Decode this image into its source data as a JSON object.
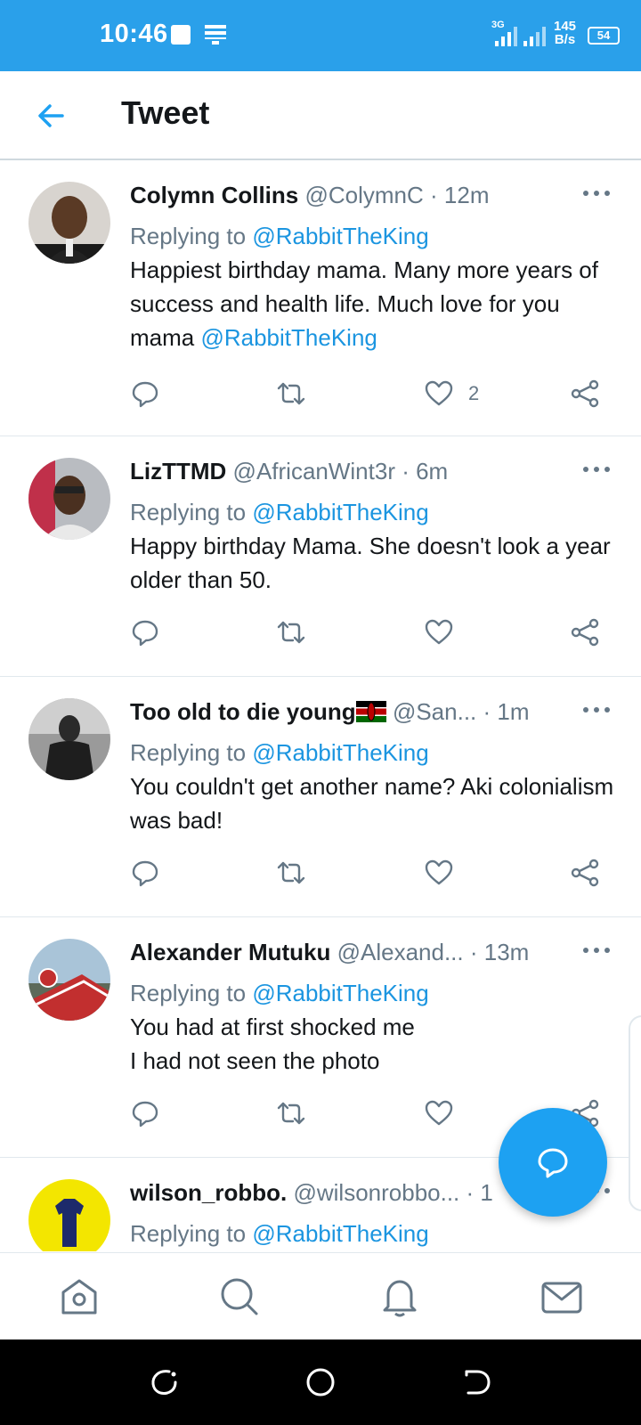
{
  "status_bar": {
    "time": "10:46",
    "network": "3G",
    "speed_value": "145",
    "speed_unit": "B/s",
    "battery": "54"
  },
  "header": {
    "title": "Tweet",
    "back_icon": "arrow-left-icon"
  },
  "tweets": [
    {
      "name": "Colymn Collins",
      "handle": "@ColymnC",
      "time": "· 12m",
      "replying_prefix": "Replying to ",
      "replying_to": "@RabbitTheKing",
      "text": "Happiest birthday mama.  Many more years of success and health life. Much love for you mama ",
      "text_mention": "@RabbitTheKing",
      "likes": "2"
    },
    {
      "name": "LizTTMD",
      "handle": "@AfricanWint3r",
      "time": "· 6m",
      "replying_prefix": "Replying to ",
      "replying_to": "@RabbitTheKing",
      "text": "Happy birthday Mama. She doesn't look a year older than 50.",
      "text_mention": "",
      "likes": ""
    },
    {
      "name": "Too old to die young",
      "handle": "@San...",
      "time": "· 1m",
      "replying_prefix": "Replying to ",
      "replying_to": "@RabbitTheKing",
      "text": "You couldn't get another name? Aki colonialism was bad!",
      "text_mention": "",
      "likes": ""
    },
    {
      "name": "Alexander Mutuku",
      "handle": "@Alexand...",
      "time": "· 13m",
      "replying_prefix": "Replying to ",
      "replying_to": "@RabbitTheKing",
      "text": "You had at first shocked me\nI had not seen the photo",
      "text_mention": "",
      "likes": ""
    },
    {
      "name": "wilson_robbo.",
      "handle": "@wilsonrobbo...",
      "time": "· 1",
      "replying_prefix": "Replying to ",
      "replying_to": "@RabbitTheKing",
      "text": "",
      "text_mention": "",
      "likes": ""
    }
  ],
  "icons": {
    "reply": "reply-icon",
    "retweet": "retweet-icon",
    "like": "heart-icon",
    "share": "share-icon",
    "more": "more-icon",
    "compose": "compose-reply-icon"
  },
  "bottom_nav": [
    "home-icon",
    "search-icon",
    "notifications-icon",
    "messages-icon"
  ],
  "colors": {
    "accent": "#1da1f2",
    "status_bar": "#2aa0ea",
    "mention": "#1b95e0",
    "secondary_text": "#657786"
  }
}
